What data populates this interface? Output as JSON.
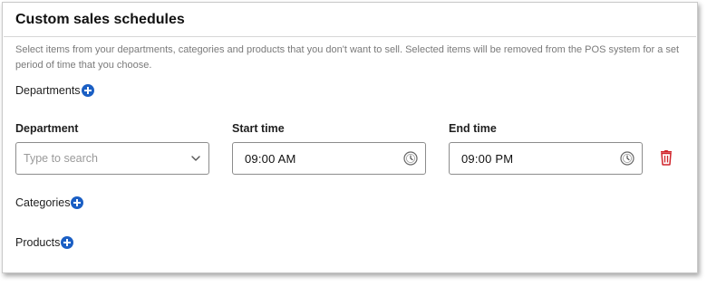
{
  "card": {
    "title": "Custom sales schedules",
    "description": "Select items from your departments, categories and products that you don't want to sell. Selected items will be removed from the POS system for a set period of time that you choose."
  },
  "sections": {
    "departments": "Departments",
    "categories": "Categories",
    "products": "Products"
  },
  "schedule_row": {
    "department_label": "Department",
    "department_placeholder": "Type to search",
    "start_label": "Start time",
    "start_value": "09:00  AM",
    "end_label": "End time",
    "end_value": "09:00  PM"
  },
  "icons": {
    "add": "plus-circle-icon",
    "dropdown": "chevron-down-icon",
    "clock": "clock-icon",
    "delete": "trash-icon"
  },
  "colors": {
    "accent": "#1b5fc4",
    "danger": "#d0242b"
  }
}
